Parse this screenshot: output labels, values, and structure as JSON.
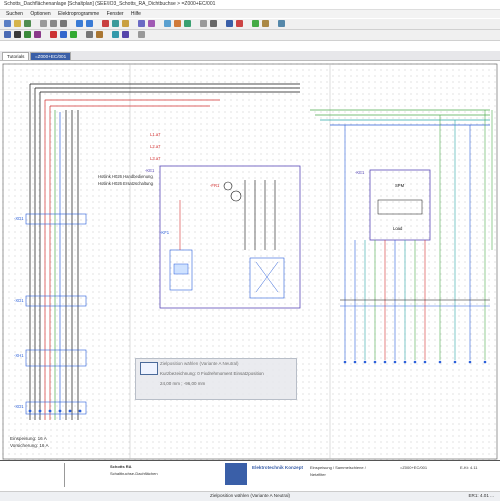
{
  "window": {
    "title": "Schotts_Dachflächenanlage [Schaltplan] (SEE\\IO3_Schotts_RA_Dichtbuchse > =Z000+EC/001"
  },
  "menu": [
    "Suchen",
    "Optionen",
    "Elektroprogramme",
    "Fenster",
    "Hilfe"
  ],
  "tabs": [
    "Tutorials",
    "=Z000+EC/001"
  ],
  "schematic": {
    "devices": {
      "left_top": "-XD1",
      "left_mid": "-XD1",
      "left_lower": "-XH1",
      "left_bottom": "-XD1",
      "center_box": "-KE1",
      "center_relay": "-KF1",
      "center_breaker": "-FR1",
      "right_box": "-KE1",
      "spm": "SPM",
      "load": "Load"
    },
    "notes": {
      "hint1": "Hotlink H026 Handbedienung",
      "hint2": "Hotlink H026 Ersatzschaltung",
      "einspeisung": "Einspeisung: 16 A",
      "absicherung": "Vorsicherung: 16 A"
    },
    "wire_labels": [
      "L1.a7",
      "L2.a7",
      "L3.a7"
    ]
  },
  "tooltip": {
    "line1": "Zielposition wählen (Variante A Neutral)",
    "line2": "Kurzbezeichnung: 0 Fixdrehmoment Einsatzposition",
    "line3": "24,00 mm ; -96,00 mm"
  },
  "titleblock": {
    "company": "Elektrotechnik Konzept",
    "desc1": "Einspeisung / Sammelschiene /",
    "desc2": "Netzfilter",
    "project": "Schotts RA",
    "project2": "Schaltbuchse-Dachflächen",
    "page": "=Z000+EC/001",
    "rev": "E-Kt: 4.11"
  },
  "status": {
    "center": "Zielposition wählen (Variante A Neutral)",
    "right": "ER1: 4.01 ..."
  },
  "colors": {
    "accent": "#3a5fa8",
    "wire_black": "#111111",
    "wire_red": "#d23030",
    "wire_green": "#4caa4c",
    "wire_blue": "#2b5fd9",
    "wire_teal": "#2aa6a6",
    "device_purple": "#5a4ab8"
  }
}
